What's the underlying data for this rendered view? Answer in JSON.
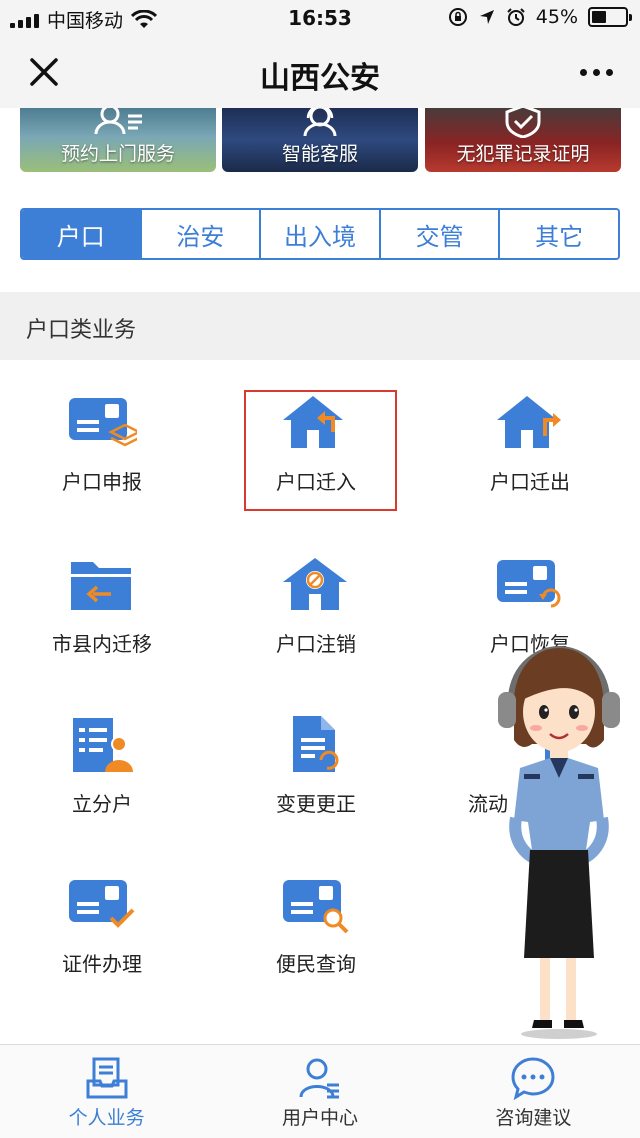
{
  "status_bar": {
    "carrier": "中国移动",
    "time": "16:53",
    "battery": "45%",
    "battery_level": 0.45
  },
  "nav": {
    "title": "山西公安"
  },
  "banners": [
    {
      "label": "预约上门服务"
    },
    {
      "label": "智能客服"
    },
    {
      "label": "无犯罪记录证明"
    }
  ],
  "tabs": [
    {
      "label": "户口",
      "active": true
    },
    {
      "label": "治安"
    },
    {
      "label": "出入境"
    },
    {
      "label": "交管"
    },
    {
      "label": "其它"
    }
  ],
  "section": {
    "title": "户口类业务"
  },
  "services": [
    {
      "label": "户口申报",
      "icon": "id-card-stack-icon"
    },
    {
      "label": "户口迁入",
      "icon": "house-arrow-in-icon"
    },
    {
      "label": "户口迁出",
      "icon": "house-arrow-out-icon"
    },
    {
      "label": "市县内迁移",
      "icon": "folder-arrow-icon"
    },
    {
      "label": "户口注销",
      "icon": "house-cancel-icon"
    },
    {
      "label": "户口恢复",
      "icon": "id-card-restore-icon"
    },
    {
      "label": "立分户",
      "icon": "document-user-icon"
    },
    {
      "label": "变更更正",
      "icon": "document-edit-icon"
    },
    {
      "label": "流动",
      "icon": "list-icon"
    },
    {
      "label": "证件办理",
      "icon": "id-card-check-icon"
    },
    {
      "label": "便民查询",
      "icon": "id-card-search-icon"
    }
  ],
  "bottom_nav": [
    {
      "label": "个人业务",
      "icon": "personal-business-icon",
      "active": true
    },
    {
      "label": "用户中心",
      "icon": "user-center-icon"
    },
    {
      "label": "咨询建议",
      "icon": "chat-bubble-icon"
    }
  ],
  "colors": {
    "accent": "#3d7fd6",
    "orange": "#f08a24",
    "highlight": "#d93a2f"
  }
}
